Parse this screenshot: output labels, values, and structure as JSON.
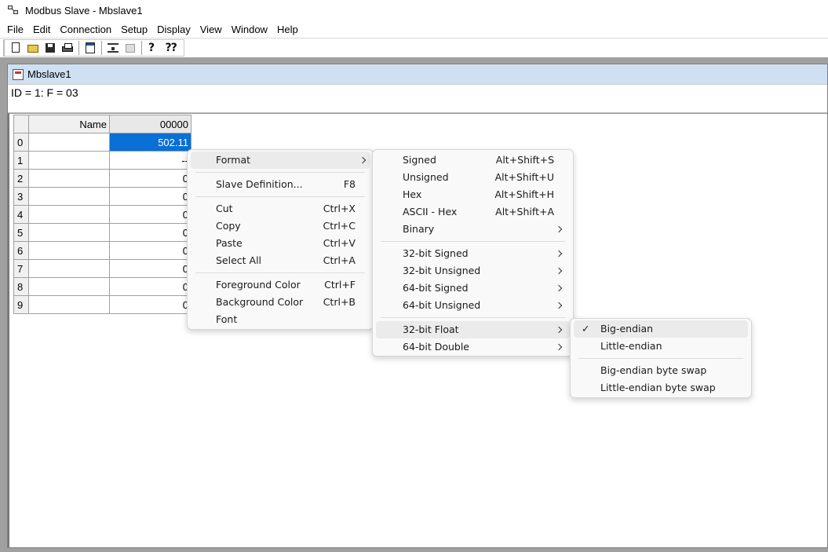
{
  "window": {
    "title": "Modbus Slave - Mbslave1"
  },
  "menubar": {
    "items": [
      "File",
      "Edit",
      "Connection",
      "Setup",
      "Display",
      "View",
      "Window",
      "Help"
    ]
  },
  "child": {
    "title": "Mbslave1",
    "header": "ID = 1: F = 03"
  },
  "grid": {
    "name_header": "Name",
    "address_header": "00000",
    "rows": [
      {
        "index": "0",
        "name": "",
        "value": "502.11"
      },
      {
        "index": "1",
        "name": "",
        "value": "--"
      },
      {
        "index": "2",
        "name": "",
        "value": "0"
      },
      {
        "index": "3",
        "name": "",
        "value": "0"
      },
      {
        "index": "4",
        "name": "",
        "value": "0"
      },
      {
        "index": "5",
        "name": "",
        "value": "0"
      },
      {
        "index": "6",
        "name": "",
        "value": "0"
      },
      {
        "index": "7",
        "name": "",
        "value": "0"
      },
      {
        "index": "8",
        "name": "",
        "value": "0"
      },
      {
        "index": "9",
        "name": "",
        "value": "0"
      }
    ]
  },
  "context_menu": {
    "format": "Format",
    "slave_definition": {
      "label": "Slave Definition...",
      "shortcut": "F8"
    },
    "cut": {
      "label": "Cut",
      "shortcut": "Ctrl+X"
    },
    "copy": {
      "label": "Copy",
      "shortcut": "Ctrl+C"
    },
    "paste": {
      "label": "Paste",
      "shortcut": "Ctrl+V"
    },
    "select_all": {
      "label": "Select All",
      "shortcut": "Ctrl+A"
    },
    "foreground_color": {
      "label": "Foreground Color",
      "shortcut": "Ctrl+F"
    },
    "background_color": {
      "label": "Background Color",
      "shortcut": "Ctrl+B"
    },
    "font": "Font"
  },
  "format_menu": {
    "signed": {
      "label": "Signed",
      "shortcut": "Alt+Shift+S"
    },
    "unsigned": {
      "label": "Unsigned",
      "shortcut": "Alt+Shift+U"
    },
    "hex": {
      "label": "Hex",
      "shortcut": "Alt+Shift+H"
    },
    "ascii_hex": {
      "label": "ASCII - Hex",
      "shortcut": "Alt+Shift+A"
    },
    "binary": "Binary",
    "signed32": "32-bit Signed",
    "unsigned32": "32-bit Unsigned",
    "signed64": "64-bit Signed",
    "unsigned64": "64-bit Unsigned",
    "float32": "32-bit Float",
    "double64": "64-bit Double"
  },
  "float_menu": {
    "big_endian": "Big-endian",
    "little_endian": "Little-endian",
    "big_endian_swap": "Big-endian byte swap",
    "little_endian_swap": "Little-endian byte swap",
    "checked_mark": "✓"
  }
}
